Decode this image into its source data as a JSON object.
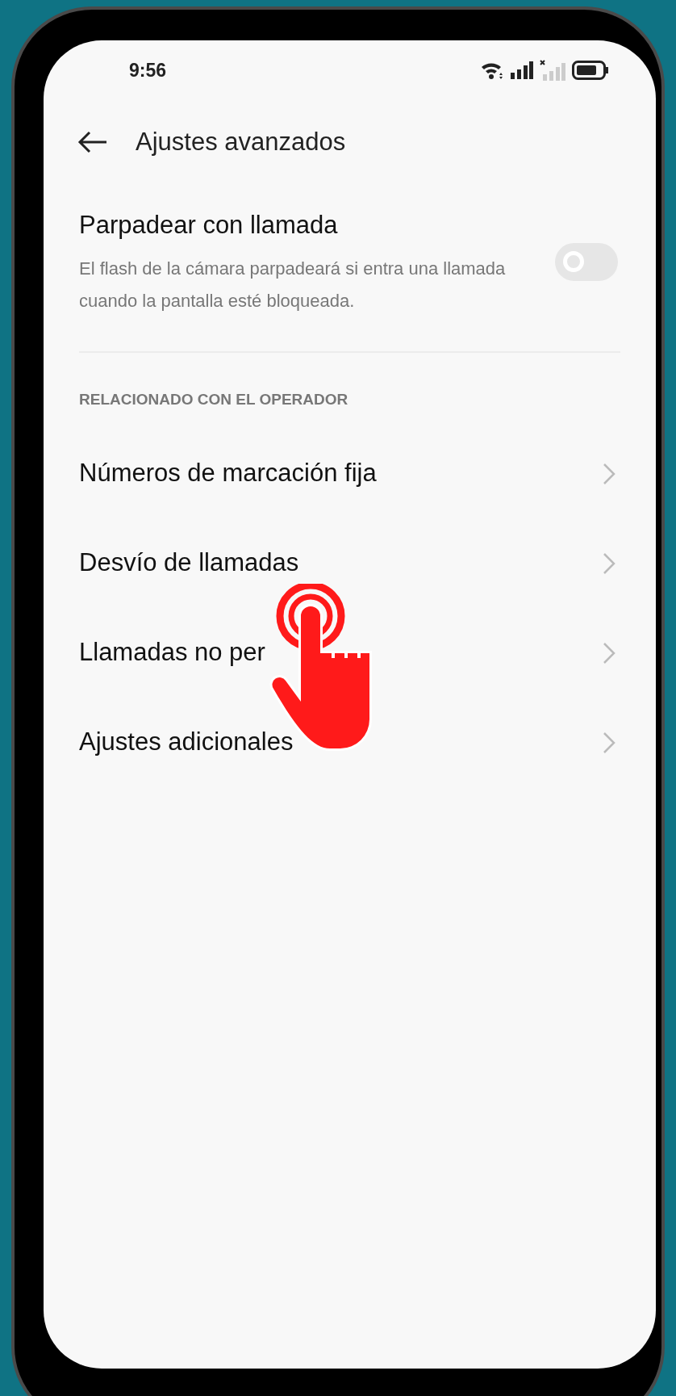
{
  "status_bar": {
    "time": "9:56"
  },
  "header": {
    "title": "Ajustes avanzados"
  },
  "toggle_setting": {
    "title": "Parpadear con llamada",
    "description": "El flash de la cámara parpadeará si entra una llamada cuando la pantalla esté bloqueada.",
    "on": false
  },
  "section": {
    "header": "RELACIONADO CON EL OPERADOR",
    "items": [
      {
        "label": "Números de marcación fija"
      },
      {
        "label": "Desvío de llamadas"
      },
      {
        "label": "Llamadas no per"
      },
      {
        "label": "Ajustes adicionales"
      }
    ]
  }
}
